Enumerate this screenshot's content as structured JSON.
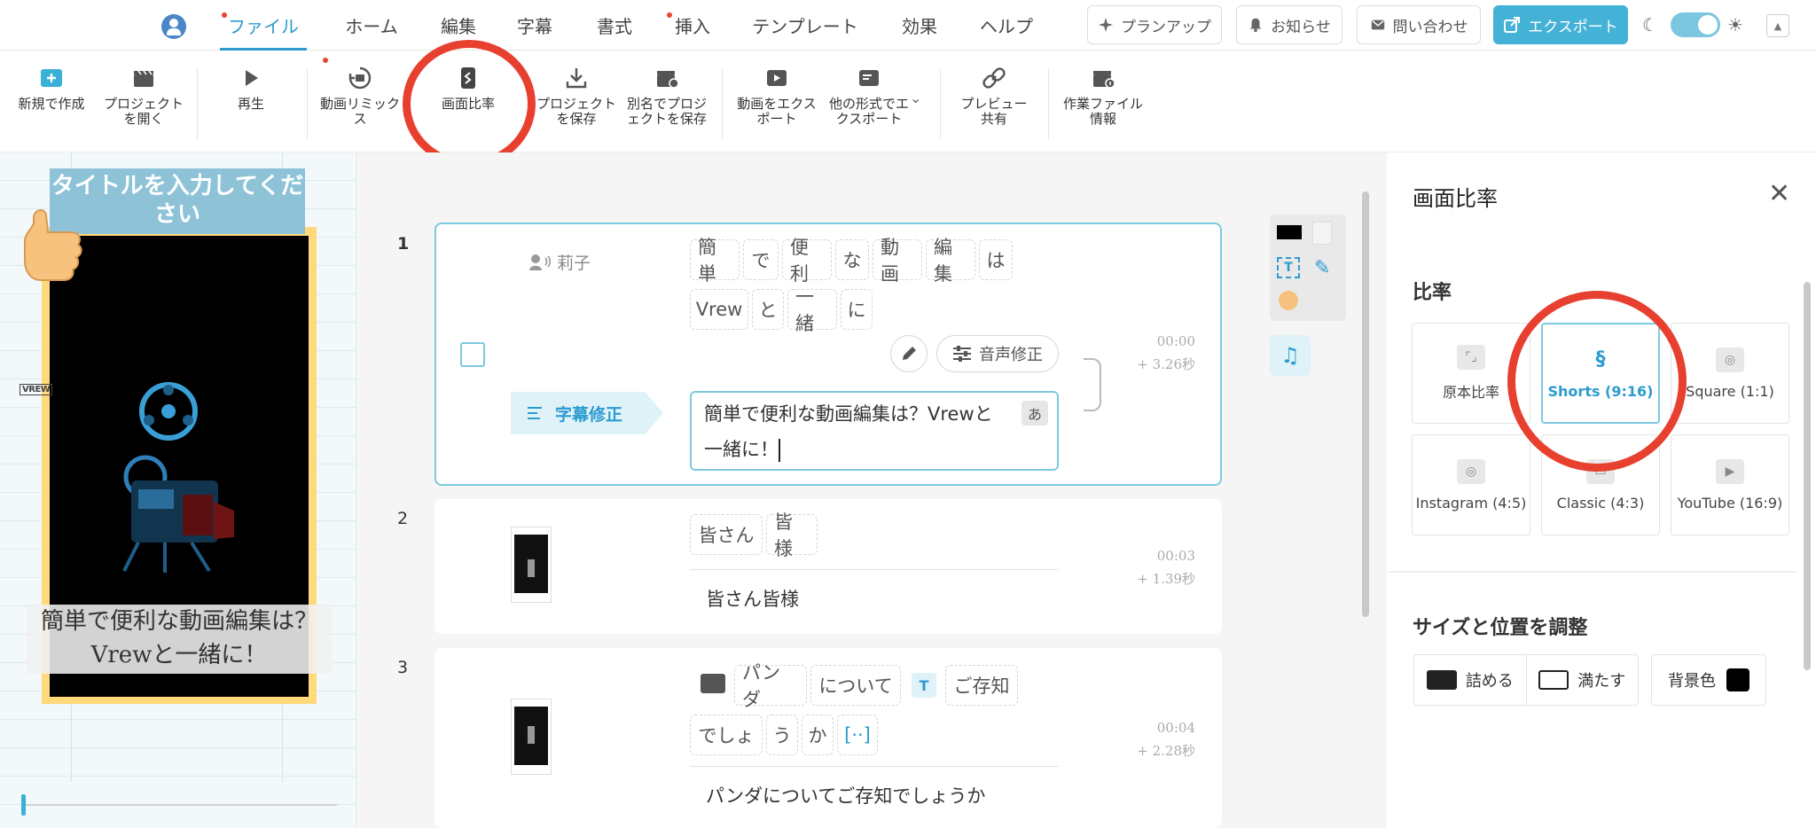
{
  "menu": {
    "items": [
      {
        "label": "ファイル",
        "active": true,
        "dot": true
      },
      {
        "label": "ホーム"
      },
      {
        "label": "編集"
      },
      {
        "label": "字幕"
      },
      {
        "label": "書式"
      },
      {
        "label": "挿入",
        "dot": true
      },
      {
        "label": "テンプレート"
      },
      {
        "label": "効果"
      },
      {
        "label": "ヘルプ"
      }
    ],
    "plan_up": "プランアップ",
    "notice": "お知らせ",
    "contact": "問い合わせ",
    "export": "エクスポート"
  },
  "ribbon": {
    "new": "新規で作成",
    "open": "プロジェクトを開く",
    "play": "再生",
    "remix": "動画リミックス",
    "aspect": "画面比率",
    "save": "プロジェクトを保存",
    "save_as": "別名でプロジェクトを保存",
    "export_video": "動画をエクスポート",
    "export_other": "他の形式でエクスポート",
    "preview_share": "プレビュー共有",
    "work_info": "作業ファイル情報"
  },
  "preview": {
    "title": "タイトルを入力してください",
    "caption": "簡単で便利な動画編集は？Vrewと一緒に！",
    "watermark": "VREW"
  },
  "clips": [
    {
      "num": "1",
      "speaker": "莉子",
      "words_line1": [
        "簡単",
        "で",
        "便利",
        "な",
        "動画",
        "編集",
        "は"
      ],
      "words_line2": [
        "Vrew",
        "と",
        "一緒",
        "に"
      ],
      "voice_fix": "音声修正",
      "subtitle_fix": "字幕修正",
      "subtitle_line1": "簡単で便利な動画編集は？Vrewと",
      "subtitle_line2": "一緒に！",
      "input_mode": "あ",
      "time": "00:00",
      "duration": "+ 3.26秒"
    },
    {
      "num": "2",
      "words": [
        "皆さん",
        "皆様"
      ],
      "subtitle": "皆さん皆様",
      "time": "00:03",
      "duration": "+ 1.39秒"
    },
    {
      "num": "3",
      "words_line1": [
        "パンダ",
        "について",
        "ご存知"
      ],
      "words_line2": [
        "でしょ",
        "う",
        "か",
        "[··]"
      ],
      "subtitle": "パンダについてご存知でしょうか",
      "time": "00:04",
      "duration": "+ 2.28秒"
    }
  ],
  "panel": {
    "title": "画面比率",
    "ratio_heading": "比率",
    "ratios": [
      {
        "label": "原本比率"
      },
      {
        "label": "Shorts (9:16)",
        "selected": true
      },
      {
        "label": "Square (1:1)"
      },
      {
        "label": "Instagram (4:5)"
      },
      {
        "label": "Classic (4:3)"
      },
      {
        "label": "YouTube (16:9)"
      }
    ],
    "size_heading": "サイズと位置を調整",
    "fit": "詰める",
    "fill": "満たす",
    "bg_color": "背景色",
    "bg_swatch": "#000000"
  },
  "colors": {
    "accent": "#2c9bd1",
    "export_bg": "#44b1d6",
    "highlight_circle": "#e8402f"
  }
}
